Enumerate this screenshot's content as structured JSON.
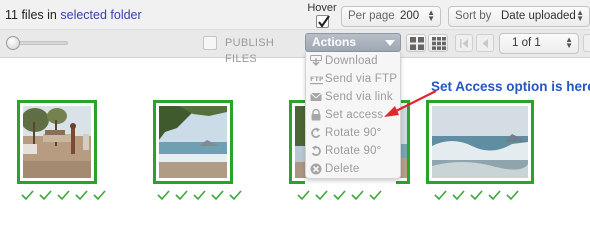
{
  "header": {
    "file_count_prefix": "11 files in",
    "folder_link": "selected folder",
    "hover_label": "Hover",
    "hover_checked": true,
    "per_page_label": "Per page",
    "per_page_value": "200",
    "sort_label": "Sort by",
    "sort_value": "Date uploaded"
  },
  "toolbar": {
    "thumbnail_size_slider": 0.0,
    "publish_label": "PUBLISH FILES",
    "actions_label": "Actions",
    "view_icons": [
      "grid-view-icon",
      "large-grid-view-icon"
    ],
    "pagination_value": "1 of 1"
  },
  "actions_menu": {
    "items": [
      {
        "label": "Download",
        "icon": "download-icon"
      },
      {
        "label": "Send via FTP",
        "icon": "ftp-icon"
      },
      {
        "label": "Send via link",
        "icon": "envelope-icon"
      },
      {
        "label": "Set access",
        "icon": "lock-icon"
      },
      {
        "label": "Rotate 90°",
        "icon": "rotate-left-icon"
      },
      {
        "label": "Rotate 90°",
        "icon": "rotate-right-icon"
      },
      {
        "label": "Delete",
        "icon": "delete-icon"
      }
    ]
  },
  "annotation": {
    "text": "Set Access option is here",
    "color": "#2456c4"
  },
  "thumbnails": [
    {
      "description_icon": "beach-photo-thumbnail",
      "checks": 5
    },
    {
      "description_icon": "coast-waves-photo-thumbnail",
      "checks": 5
    },
    {
      "description_icon": "coast-palms-photo-thumbnail",
      "checks": 5
    },
    {
      "description_icon": "waves-photo-thumbnail",
      "checks": 5
    }
  ],
  "colors": {
    "selection_border": "#2aa32a",
    "check_mark": "#3aa83a",
    "link": "#3b3fa8",
    "annotation_arrow": "#e0262e"
  }
}
